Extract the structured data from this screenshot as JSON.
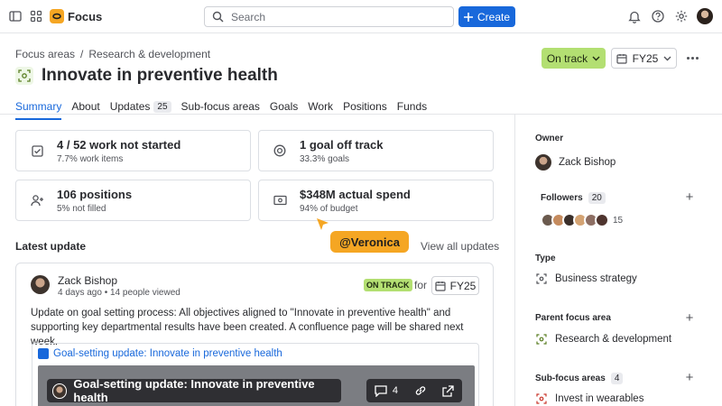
{
  "topbar": {
    "app_name": "Focus",
    "search_placeholder": "Search",
    "create_label": "Create"
  },
  "header": {
    "breadcrumb": [
      "Focus areas",
      "/",
      "Research & development"
    ],
    "title": "Innovate in preventive health",
    "status_label": "On track",
    "fiscal_year": "FY25"
  },
  "tabs": [
    {
      "label": "Summary",
      "active": true
    },
    {
      "label": "About"
    },
    {
      "label": "Updates",
      "badge": "25"
    },
    {
      "label": "Sub-focus areas"
    },
    {
      "label": "Goals"
    },
    {
      "label": "Work"
    },
    {
      "label": "Positions"
    },
    {
      "label": "Funds"
    }
  ],
  "stats": [
    {
      "value": "4 / 52 work not started",
      "sub": "7.7% work items",
      "icon": "checkbox-icon"
    },
    {
      "value": "1 goal off track",
      "sub": "33.3% goals",
      "icon": "target-icon"
    },
    {
      "value": "106 positions",
      "sub": "5% not filled",
      "icon": "person-add-icon"
    },
    {
      "value": "$348M actual spend",
      "sub": "94% of budget",
      "icon": "money-icon"
    }
  ],
  "latest": {
    "label": "Latest update",
    "view_all": "View all updates",
    "mention": "@Veronica",
    "author": "Zack Bishop",
    "meta": "4 days ago • 14 people viewed",
    "status": "ON TRACK",
    "for_label": "for",
    "fiscal_year": "FY25",
    "body": "Update on goal setting process: All objectives aligned to \"Innovate in preventive health\" and supporting key departmental results have been created. A confluence page will be shared next week.",
    "link_title": "Goal-setting update: Innovate in preventive health",
    "preview_title": "Goal-setting update: Innovate in preventive health",
    "comment_count": "4"
  },
  "sidebar": {
    "owner_label": "Owner",
    "owner_name": "Zack Bishop",
    "followers_label": "Followers",
    "followers_count": "20",
    "followers_more": "15",
    "follower_colors": [
      "#6b5a4e",
      "#c58b5e",
      "#3a2f2a",
      "#d4a373",
      "#8d6e63",
      "#4e342e"
    ],
    "type_label": "Type",
    "type_value": "Business strategy",
    "parent_label": "Parent focus area",
    "parent_value": "Research & development",
    "sub_label": "Sub-focus areas",
    "sub_count": "4",
    "sub_value": "Invest in wearables"
  },
  "colors": {
    "accent": "#1868db",
    "on_track": "#b3df72",
    "mention": "#f5a623"
  }
}
